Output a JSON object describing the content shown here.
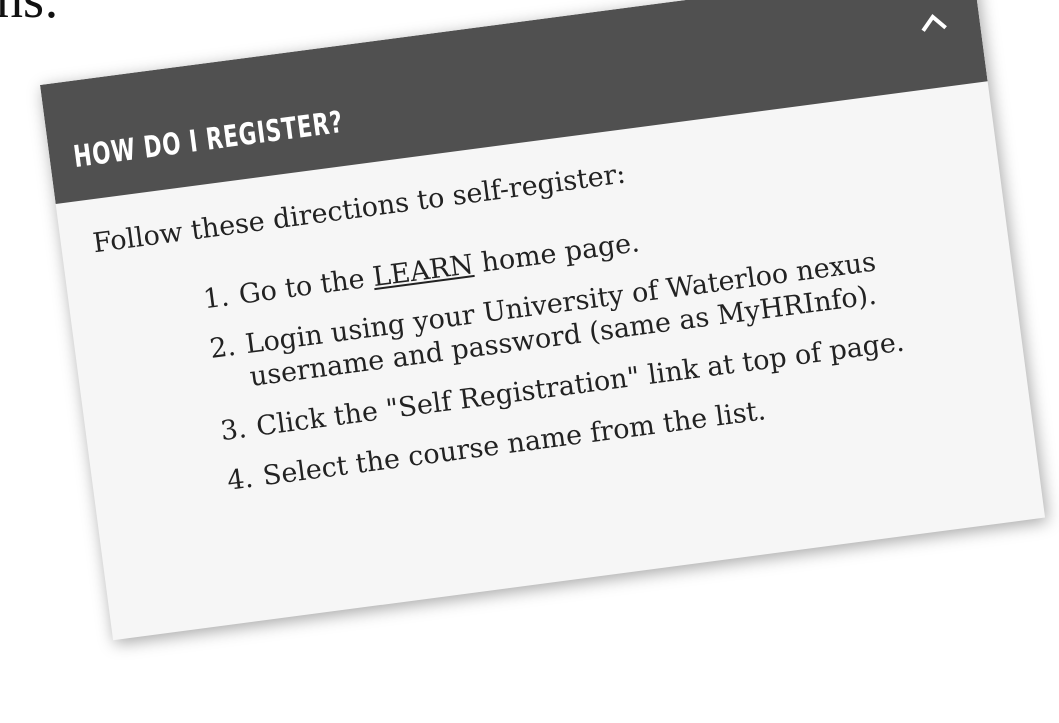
{
  "page": {
    "top_fragment": "ns:"
  },
  "card": {
    "title": "HOW DO I REGISTER?",
    "collapse_icon": "chevron-up-icon",
    "intro": "Follow these directions to self-register:",
    "steps": [
      {
        "number": "1.",
        "text_before": "Go to the ",
        "link_text": "LEARN",
        "text_after": " home page."
      },
      {
        "number": "2.",
        "text": "Login using your University of Waterloo nexus username and password (same as MyHRInfo)."
      },
      {
        "number": "3.",
        "text": "Click the \"Self Registration\" link at top of page."
      },
      {
        "number": "4.",
        "text": "Select the course name from the list."
      }
    ]
  },
  "colors": {
    "header_bg": "#505050",
    "body_bg": "#f6f6f6",
    "text": "#222222"
  }
}
